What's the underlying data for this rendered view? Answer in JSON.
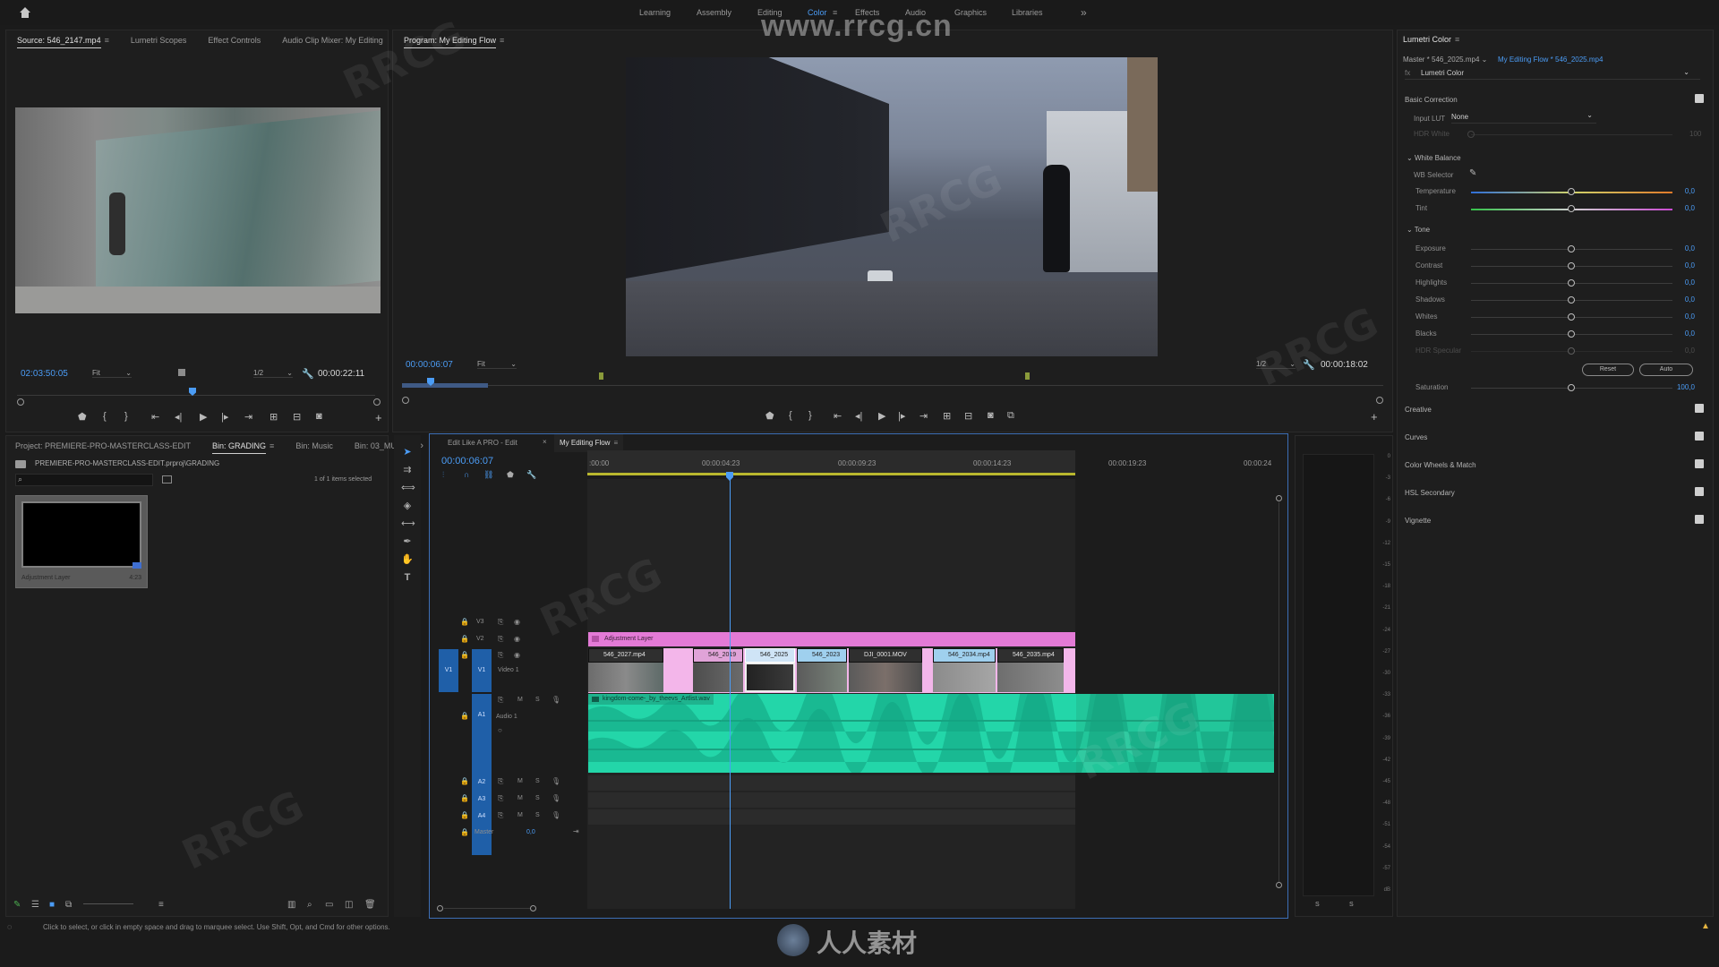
{
  "workspaces": {
    "items": [
      "Learning",
      "Assembly",
      "Editing",
      "Color",
      "Effects",
      "Audio",
      "Graphics",
      "Libraries"
    ],
    "active": "Color",
    "more": "»"
  },
  "watermark": {
    "url": "www.rrcg.cn",
    "bottom_logo": "人人素材"
  },
  "source": {
    "tabs": [
      "Source: 546_2147.mp4",
      "Lumetri Scopes",
      "Effect Controls",
      "Audio Clip Mixer: My Editing"
    ],
    "more": "»",
    "timecode": "02:03:50:05",
    "fit": "Fit",
    "resolution": "1/2",
    "duration": "00:00:22:11",
    "playhead_fraction": 0.49
  },
  "program": {
    "tab": "Program: My Editing Flow",
    "timecode": "00:00:06:07",
    "fit": "Fit",
    "resolution": "1/2",
    "duration": "00:00:18:02"
  },
  "project": {
    "tabs": [
      "Project: PREMIERE-PRO-MASTERCLASS-EDIT",
      "Bin: GRADING",
      "Bin: Music",
      "Bin: 03_MU"
    ],
    "more": "»",
    "path": "PREMIERE-PRO-MASTERCLASS-EDIT.prproj\\GRADING",
    "selection": "1 of 1 items selected",
    "item_name": "Adjustment Layer",
    "item_duration": "4:23"
  },
  "timeline": {
    "tabs": [
      "Edit Like A PRO - Edit",
      "My Editing Flow"
    ],
    "timecode": "00:00:06:07",
    "ruler": [
      ":00:00",
      "00:00:04:23",
      "00:00:09:23",
      "00:00:14:23",
      "00:00:19:23",
      "00:00:24"
    ],
    "tracks": {
      "v3": "V3",
      "v2": "V2",
      "v1": "V1",
      "video1": "Video 1",
      "a1": "A1",
      "audio1": "Audio 1",
      "a2": "A2",
      "a3": "A3",
      "a4": "A4",
      "master": "Master",
      "master_value": "0,0",
      "m": "M",
      "s": "S"
    },
    "adjustment_clip": "Adjustment Layer",
    "clips": [
      "546_2027.mp4",
      "546_2019",
      "546_2025",
      "546_2023",
      "DJI_0001.MOV",
      "546_2034.mp4",
      "546_2035.mp4"
    ],
    "audio_clip": "kingdom-come-_by_theevs_Artlist.wav"
  },
  "meter": {
    "scale": [
      "0",
      "-3",
      "-6",
      "-9",
      "-12",
      "-15",
      "-18",
      "-21",
      "-24",
      "-27",
      "-30",
      "-33",
      "-36",
      "-39",
      "-42",
      "-45",
      "-48",
      "-51",
      "-54",
      "-57",
      "dB"
    ],
    "solo": [
      "S",
      "S"
    ]
  },
  "lumetri": {
    "title": "Lumetri Color",
    "master": "Master * 546_2025.mp4",
    "sequence": "My Editing Flow * 546_2025.mp4",
    "effect": "Lumetri Color",
    "basic_correction": "Basic Correction",
    "input_lut_label": "Input LUT",
    "input_lut_value": "None",
    "hdr_white": "HDR White",
    "hdr_white_value": "100",
    "white_balance": "White Balance",
    "wb_selector": "WB Selector",
    "tone": "Tone",
    "sliders": [
      {
        "name": "Temperature",
        "value": "0,0"
      },
      {
        "name": "Tint",
        "value": "0,0"
      },
      {
        "name": "Exposure",
        "value": "0,0"
      },
      {
        "name": "Contrast",
        "value": "0,0"
      },
      {
        "name": "Highlights",
        "value": "0,0"
      },
      {
        "name": "Shadows",
        "value": "0,0"
      },
      {
        "name": "Whites",
        "value": "0,0"
      },
      {
        "name": "Blacks",
        "value": "0,0"
      },
      {
        "name": "HDR Specular",
        "value": "0,0"
      },
      {
        "name": "Saturation",
        "value": "100,0"
      }
    ],
    "reset": "Reset",
    "auto": "Auto",
    "sections": [
      "Creative",
      "Curves",
      "Color Wheels & Match",
      "HSL Secondary",
      "Vignette"
    ]
  },
  "status": {
    "message": "Click to select, or click in empty space and drag to marquee select. Use Shift, Opt, and Cmd for other options."
  }
}
